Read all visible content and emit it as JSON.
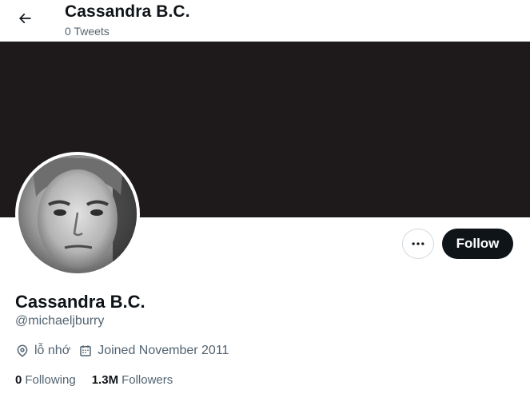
{
  "header": {
    "title": "Cassandra B.C.",
    "tweet_count": "0 Tweets",
    "back_icon": "arrow-left-icon"
  },
  "banner": {
    "color": "#1e1a1b"
  },
  "actions": {
    "more_icon": "more-horizontal-icon",
    "follow_label": "Follow"
  },
  "profile": {
    "display_name": "Cassandra B.C.",
    "handle": "@michaeljburry",
    "location": "lỗ nhớ",
    "location_icon": "location-pin-icon",
    "joined": "Joined November 2011",
    "joined_icon": "calendar-icon"
  },
  "stats": {
    "following_count": "0",
    "following_label": "Following",
    "followers_count": "1.3M",
    "followers_label": "Followers"
  },
  "colors": {
    "text_primary": "#0f1419",
    "text_secondary": "#536471",
    "button_dark": "#0f1419",
    "border": "#cfd9de"
  }
}
